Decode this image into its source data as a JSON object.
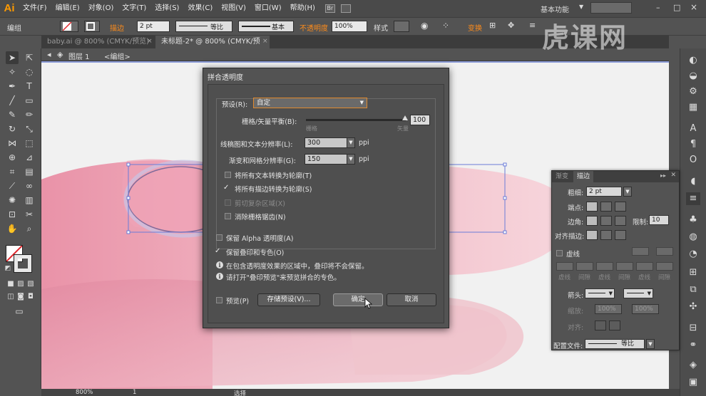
{
  "app": {
    "logo": "Ai"
  },
  "menubar": {
    "items": [
      "文件(F)",
      "编辑(E)",
      "对象(O)",
      "文字(T)",
      "选择(S)",
      "效果(C)",
      "视图(V)",
      "窗口(W)",
      "帮助(H)"
    ],
    "bridge_label": "Br",
    "workspace": "基本功能",
    "window_min": "–",
    "window_max": "□",
    "window_close": "×"
  },
  "controlbar": {
    "selection_label": "编组",
    "stroke_label": "描边",
    "stroke_weight": "2 pt",
    "profile": "等比",
    "brush": "基本",
    "opacity_label": "不透明度",
    "opacity": "100%",
    "style_label": "样式",
    "align_label": "变换"
  },
  "tabs": [
    {
      "label": "baby.ai @ 800% (CMYK/预览)",
      "close": "×"
    },
    {
      "label": "未标题-2* @ 800% (CMYK/预览)",
      "close": "×"
    }
  ],
  "breadcrumb": {
    "layer": "图层 1",
    "group": "<编组>"
  },
  "watermark": "虎课网",
  "dialog": {
    "title": "拼合透明度",
    "preset_label": "预设(R):",
    "preset_value": "自定",
    "raster_vector_label": "栅格/矢量平衡(B):",
    "raster_vector_value": "100",
    "raster_vector_level": 1.0,
    "raster_label": "栅格",
    "vector_label": "矢量",
    "line_art_label": "线稿图和文本分辨率(L):",
    "line_art_value": "300",
    "gradient_mesh_label": "渐变和网格分辨率(G):",
    "gradient_mesh_value": "150",
    "unit": "ppi",
    "opt_text_outline": "将所有文本转换为轮廓(T)",
    "opt_stroke_outline": "将所有描边转换为轮廓(S)",
    "opt_clip_complex": "剪切复杂区域(X)",
    "opt_antialias": "消除栅格锯齿(N)",
    "opt_preserve_alpha": "保留 Alpha 透明度(A)",
    "opt_preserve_overprint": "保留叠印和专色(O)",
    "info_1": "在包含透明度效果的区域中，叠印将不会保留。",
    "info_2": "请打开\"叠印预览\"来预览拼合的专色。",
    "preview_label": "预览(P)",
    "save_preset": "存储预设(V)...",
    "ok": "确定",
    "cancel": "取消"
  },
  "stroke_panel": {
    "tab_stroke": "描边",
    "tab_gradient": "渐变",
    "weight_label": "粗细:",
    "weight_value": "2 pt",
    "cap_label": "端点:",
    "corner_label": "边角:",
    "limit_label": "限制:",
    "limit_value": "10",
    "align_label": "对齐描边:",
    "dashed_label": "虚线",
    "dash_labels": [
      "虚线",
      "间隙",
      "虚线",
      "间隙",
      "虚线",
      "间隙"
    ],
    "arrow_label": "箭头:",
    "scale_label": "缩放:",
    "scale_1": "100%",
    "scale_2": "100%",
    "align2_label": "对齐:",
    "profile_label": "配置文件:",
    "profile_value": "等比"
  },
  "statusbar": {
    "zoom": "800%",
    "page": "1",
    "tool": "选择"
  },
  "colors": {
    "accent_orange": "#ff8c1a",
    "artwork_pink": "#e592a8"
  }
}
